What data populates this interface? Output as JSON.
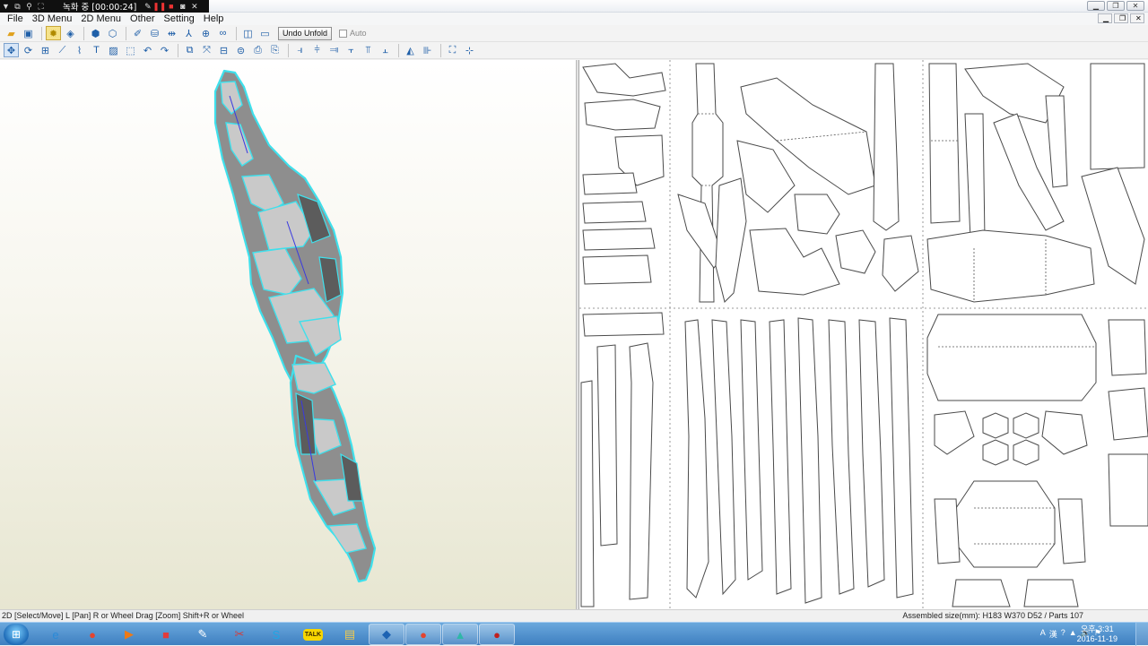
{
  "recorder": {
    "title": "녹화 중 [00:00:24]"
  },
  "menu": {
    "items": [
      "File",
      "3D Menu",
      "2D Menu",
      "Other",
      "Setting",
      "Help"
    ]
  },
  "toolbar": {
    "undo_unfold_label": "Undo Unfold",
    "auto_label": "Auto"
  },
  "status": {
    "hint": "2D [Select/Move] L [Pan] R or Wheel Drag [Zoom] Shift+R or Wheel",
    "assembled": "Assembled size(mm): H183 W370 D52 / Parts 107"
  },
  "taskbar": {
    "apps": [
      {
        "name": "internet-explorer-icon",
        "glyph": "e",
        "color": "#2a8ad8",
        "open": false
      },
      {
        "name": "chrome-icon",
        "glyph": "●",
        "color": "#e4442f",
        "open": false
      },
      {
        "name": "media-player-icon",
        "glyph": "▶",
        "color": "#ee7a16",
        "open": false
      },
      {
        "name": "red-app-icon",
        "glyph": "■",
        "color": "#e23b3b",
        "open": false
      },
      {
        "name": "paint-icon",
        "glyph": "✎",
        "color": "#ffffff",
        "open": false
      },
      {
        "name": "tool-icon",
        "glyph": "✂",
        "color": "#d23c3c",
        "open": false
      },
      {
        "name": "skype-icon",
        "glyph": "S",
        "color": "#1fa5e6",
        "open": false
      },
      {
        "name": "kakaotalk-icon",
        "glyph": "TALK",
        "color": "#3a2a00",
        "open": false
      },
      {
        "name": "explorer-folder-icon",
        "glyph": "▤",
        "color": "#f2c94c",
        "open": false
      },
      {
        "name": "blue-app-icon",
        "glyph": "◆",
        "color": "#1d63b3",
        "open": true
      },
      {
        "name": "chrome-icon-2",
        "glyph": "●",
        "color": "#e4442f",
        "open": true
      },
      {
        "name": "pepakura-icon",
        "glyph": "▲",
        "color": "#2fb7a7",
        "open": true
      },
      {
        "name": "record-app-icon",
        "glyph": "●",
        "color": "#c0201f",
        "open": true
      }
    ],
    "tray": [
      "A",
      "漢",
      "?",
      "▲",
      "🔊",
      "⚑"
    ],
    "time": "오후 3:31",
    "date": "2016-11-19"
  },
  "colors": {
    "model_edge": "#39d3e0",
    "model_face": "#8c8c8c",
    "model_face_light": "#c4c4c4"
  }
}
